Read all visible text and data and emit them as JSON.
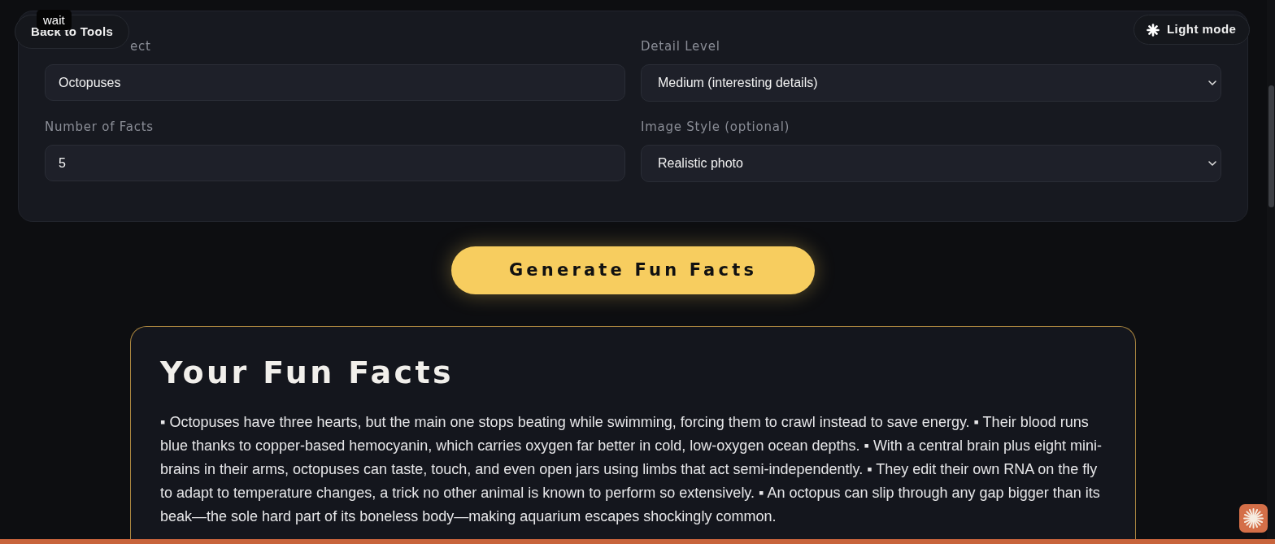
{
  "header": {
    "back_button": {
      "label": "Back to Tools"
    },
    "tooltip": {
      "text": "wait"
    },
    "theme_button": {
      "label": "Light mode"
    }
  },
  "form": {
    "fields": [
      {
        "label": "ect",
        "kind": "text",
        "value": "Octopuses"
      },
      {
        "label": "Detail Level",
        "kind": "select",
        "value": "Medium (interesting details)"
      },
      {
        "label": "Number of Facts",
        "kind": "text",
        "value": "5"
      },
      {
        "label": "Image Style (optional)",
        "kind": "select",
        "value": "Realistic photo"
      }
    ]
  },
  "generate_button": {
    "label": "Generate Fun Facts"
  },
  "results": {
    "title": "Your Fun Facts",
    "text": "▪ Octopuses have three hearts, but the main one stops beating while swimming, forcing them to crawl instead to save energy. ▪ Their blood runs blue thanks to copper-based hemocyanin, which carries oxygen far better in cold, low-oxygen ocean depths. ▪ With a central brain plus eight mini-brains in their arms, octopuses can taste, touch, and even open jars using limbs that act semi-independently. ▪ They edit their own RNA on the fly to adapt to temperature changes, a trick no other animal is known to perform so extensively. ▪ An octopus can slip through any gap bigger than its beak—the sole hard part of its boneless body—making aquarium escapes shockingly common."
  }
}
